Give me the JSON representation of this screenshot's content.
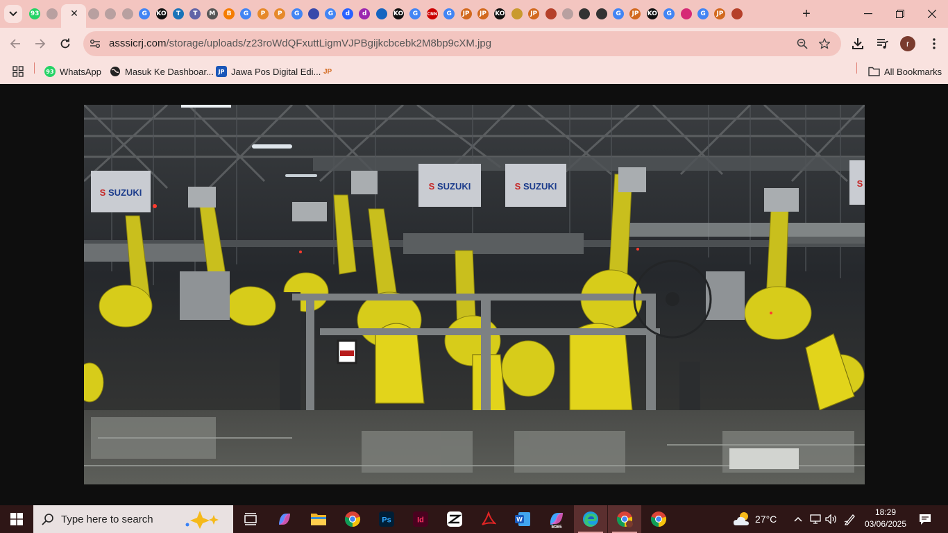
{
  "browser": {
    "tabs": [
      {
        "icon": "whatsapp-icon",
        "label": "93",
        "color": "#25d366"
      },
      {
        "icon": "tab-favicon-gray",
        "label": "",
        "color": "#b8a0a0"
      },
      {
        "icon": "tab-favicon-gray",
        "label": "",
        "color": "#b8a0a0"
      },
      {
        "icon": "tab-favicon-gray",
        "label": "",
        "color": "#b8a0a0"
      },
      {
        "icon": "tab-favicon-gray",
        "label": "",
        "color": "#b8a0a0"
      },
      {
        "icon": "tab-favicon-gray",
        "label": "",
        "color": "#b8a0a0"
      },
      {
        "icon": "google-icon",
        "label": "G",
        "color": "#4285f4"
      },
      {
        "icon": "ko-icon",
        "label": "KO",
        "color": "#111111"
      },
      {
        "icon": "t-icon",
        "label": "T",
        "color": "#1a73b8"
      },
      {
        "icon": "teams-icon",
        "label": "T",
        "color": "#6264a7"
      },
      {
        "icon": "mail-icon",
        "label": "M",
        "color": "#555555"
      },
      {
        "icon": "blogger-icon",
        "label": "B",
        "color": "#f57c00"
      },
      {
        "icon": "google-icon",
        "label": "G",
        "color": "#4285f4"
      },
      {
        "icon": "p-icon",
        "label": "P",
        "color": "#e6892a"
      },
      {
        "icon": "p-icon",
        "label": "P",
        "color": "#e6892a"
      },
      {
        "icon": "google-icon",
        "label": "G",
        "color": "#4285f4"
      },
      {
        "icon": "circle-icon",
        "label": "",
        "color": "#3949ab"
      },
      {
        "icon": "google-icon",
        "label": "G",
        "color": "#4285f4"
      },
      {
        "icon": "d-icon",
        "label": "d",
        "color": "#2962ff"
      },
      {
        "icon": "d-icon",
        "label": "d",
        "color": "#9c27b0"
      },
      {
        "icon": "link-icon",
        "label": "",
        "color": "#1565c0"
      },
      {
        "icon": "ko-icon",
        "label": "KO",
        "color": "#111111"
      },
      {
        "icon": "google-icon",
        "label": "G",
        "color": "#4285f4"
      },
      {
        "icon": "cnn-icon",
        "label": "CNN",
        "color": "#cc0000"
      },
      {
        "icon": "google-icon",
        "label": "G",
        "color": "#4285f4"
      },
      {
        "icon": "jp-icon",
        "label": "JP",
        "color": "#d2691e"
      },
      {
        "icon": "jp-icon",
        "label": "JP",
        "color": "#d2691e"
      },
      {
        "icon": "ko-icon",
        "label": "KO",
        "color": "#111111"
      },
      {
        "icon": "emblem-icon",
        "label": "",
        "color": "#c99a2e"
      },
      {
        "icon": "jp-icon",
        "label": "JP",
        "color": "#d2691e"
      },
      {
        "icon": "shield-icon",
        "label": "",
        "color": "#b5402a"
      },
      {
        "icon": "tab-favicon-gray",
        "label": "",
        "color": "#b8a0a0"
      },
      {
        "icon": "github-icon",
        "label": "",
        "color": "#333333"
      },
      {
        "icon": "github-icon",
        "label": "",
        "color": "#333333"
      },
      {
        "icon": "google-icon",
        "label": "G",
        "color": "#4285f4"
      },
      {
        "icon": "jp-icon",
        "label": "JP",
        "color": "#d2691e"
      },
      {
        "icon": "ko-icon",
        "label": "KO",
        "color": "#111111"
      },
      {
        "icon": "google-icon",
        "label": "G",
        "color": "#4285f4"
      },
      {
        "icon": "instagram-icon",
        "label": "",
        "color": "#d62976"
      },
      {
        "icon": "google-icon",
        "label": "G",
        "color": "#4285f4"
      },
      {
        "icon": "jp-icon",
        "label": "JP",
        "color": "#d2691e"
      },
      {
        "icon": "shield-icon",
        "label": "",
        "color": "#b5402a"
      }
    ],
    "address": {
      "host": "asssicrj.com",
      "path": "/storage/uploads/z23roWdQFxuttLigmVJPBgijkcbcebk2M8bp9cXM.jpg"
    },
    "bookmarks": [
      {
        "label": "WhatsApp",
        "icon": "whatsapp-icon",
        "badge": "93"
      },
      {
        "label": "Masuk Ke Dashboar...",
        "icon": "globe-icon"
      },
      {
        "label": "Jawa Pos Digital Edi...",
        "icon": "jp-icon"
      },
      {
        "label": "",
        "icon": "jp-icon"
      }
    ],
    "all_bookmarks_label": "All Bookmarks",
    "profile_initial": "r"
  },
  "photo": {
    "signs": [
      "SUZUKI",
      "SUZUKI",
      "SUZUKI",
      "S"
    ]
  },
  "taskbar": {
    "search_placeholder": "Type here to search",
    "apps": [
      "task-view-icon",
      "copilot-icon",
      "file-explorer-icon",
      "chrome-icon",
      "photoshop-icon",
      "indesign-icon",
      "capcut-icon",
      "acrobat-icon",
      "word-icon",
      "m365-icon",
      "edge-icon",
      "chrome-icon",
      "chrome-icon"
    ],
    "temperature": "27°C",
    "time": "18:29",
    "date": "03/06/2025"
  },
  "colors": {
    "tabstrip": "#f3c5c0",
    "toolbar": "#f9e2df",
    "taskbar": "#2e1616",
    "robot_yellow": "#d7cc1a"
  }
}
